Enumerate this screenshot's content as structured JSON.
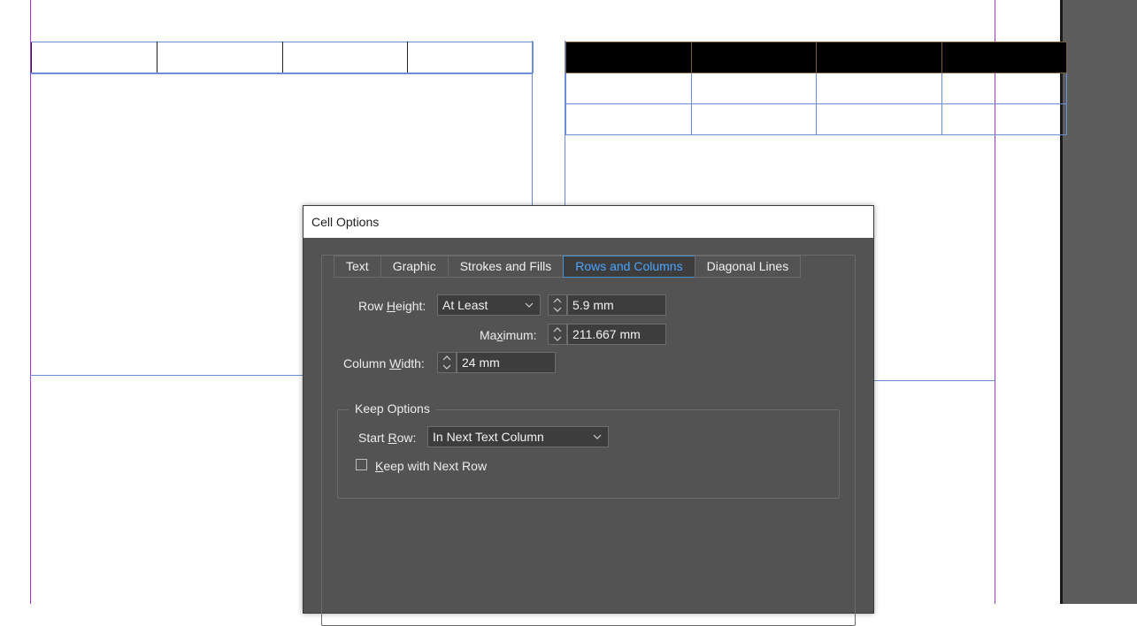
{
  "dialog": {
    "title": "Cell Options",
    "tabs": [
      {
        "label": "Text"
      },
      {
        "label": "Graphic"
      },
      {
        "label": "Strokes and Fills"
      },
      {
        "label": "Rows and Columns",
        "active": true
      },
      {
        "label": "Diagonal Lines"
      }
    ],
    "row_height": {
      "label_pre": "Row ",
      "label_key": "H",
      "label_post": "eight:",
      "mode": "At Least",
      "value": "5.9 mm"
    },
    "maximum": {
      "label_pre": "Ma",
      "label_key": "x",
      "label_post": "imum:",
      "value": "211.667 mm"
    },
    "column_width": {
      "label_pre": "Column ",
      "label_key": "W",
      "label_post": "idth:",
      "value": "24 mm"
    },
    "keep_options": {
      "title": "Keep Options",
      "start_row_pre": "Start ",
      "start_row_key": "R",
      "start_row_post": "ow:",
      "start_row_value": "In Next Text Column",
      "keep_next_key": "K",
      "keep_next_post": "eep with Next Row",
      "keep_next_checked": false
    }
  },
  "colors": {
    "dialog_bg": "#535353",
    "active_tab": "#4aa3ff",
    "guide": "#a23ad1",
    "frame": "#6a8fd6",
    "pasteboard": "#5d5d5d"
  }
}
